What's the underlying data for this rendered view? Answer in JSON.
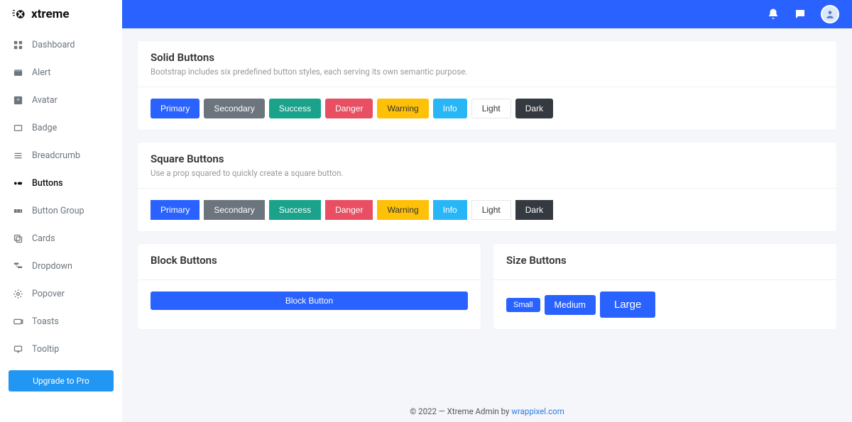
{
  "brand": {
    "name": "xtreme"
  },
  "sidebar": {
    "items": [
      {
        "label": "Dashboard"
      },
      {
        "label": "Alert"
      },
      {
        "label": "Avatar"
      },
      {
        "label": "Badge"
      },
      {
        "label": "Breadcrumb"
      },
      {
        "label": "Buttons"
      },
      {
        "label": "Button Group"
      },
      {
        "label": "Cards"
      },
      {
        "label": "Dropdown"
      },
      {
        "label": "Popover"
      },
      {
        "label": "Toasts"
      },
      {
        "label": "Tooltip"
      }
    ],
    "upgrade": "Upgrade to Pro"
  },
  "cards": {
    "solid": {
      "title": "Solid Buttons",
      "sub": "Bootstrap includes six predefined button styles, each serving its own semantic purpose."
    },
    "square": {
      "title": "Square Buttons",
      "sub": "Use a prop squared to quickly create a square button."
    },
    "block": {
      "title": "Block Buttons",
      "button": "Block Button"
    },
    "size": {
      "title": "Size Buttons",
      "small": "Small",
      "medium": "Medium",
      "large": "Large"
    }
  },
  "buttons": {
    "primary": "Primary",
    "secondary": "Secondary",
    "success": "Success",
    "danger": "Danger",
    "warning": "Warning",
    "info": "Info",
    "light": "Light",
    "dark": "Dark"
  },
  "footer": {
    "text": "© 2022 — Xtreme Admin by ",
    "link": "wrappixel.com"
  }
}
